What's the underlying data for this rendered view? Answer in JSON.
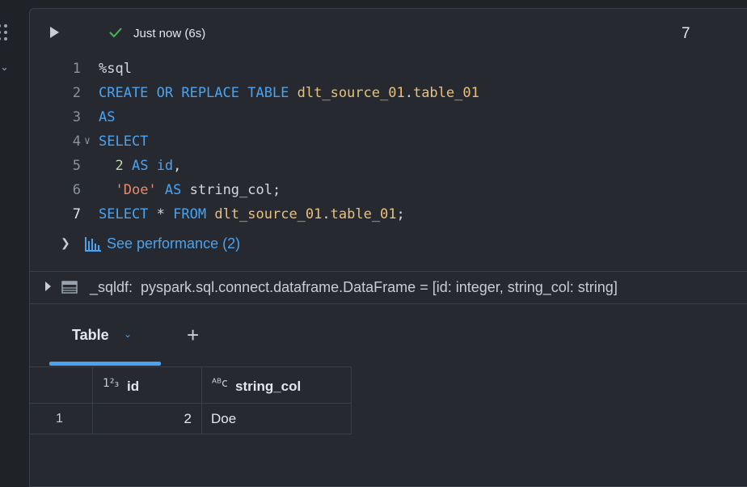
{
  "cell_header": {
    "status_text": "Just now (6s)",
    "execution_count": "7",
    "status_color": "#3fb950"
  },
  "code_lines": [
    {
      "number": "1",
      "parts": [
        {
          "text": "%sql",
          "class": "plain"
        }
      ]
    },
    {
      "number": "2",
      "parts": [
        {
          "text": "CREATE OR REPLACE TABLE ",
          "class": "kw"
        },
        {
          "text": "dlt_source_01",
          "class": "tbl"
        },
        {
          "text": ".",
          "class": "plain"
        },
        {
          "text": "table_01",
          "class": "tbl"
        }
      ]
    },
    {
      "number": "3",
      "parts": [
        {
          "text": "AS",
          "class": "kw"
        }
      ]
    },
    {
      "number": "4",
      "parts": [
        {
          "text": "SELECT",
          "class": "kw"
        }
      ]
    },
    {
      "number": "5",
      "parts": [
        {
          "text": "  ",
          "class": "plain"
        },
        {
          "text": "2",
          "class": "num"
        },
        {
          "text": " AS ",
          "class": "kw"
        },
        {
          "text": "id",
          "class": "kw"
        },
        {
          "text": ",",
          "class": "plain"
        }
      ]
    },
    {
      "number": "6",
      "parts": [
        {
          "text": "  ",
          "class": "plain"
        },
        {
          "text": "'Doe'",
          "class": "str"
        },
        {
          "text": " AS ",
          "class": "kw"
        },
        {
          "text": "string_col;",
          "class": "plain"
        }
      ]
    },
    {
      "number": "7",
      "parts": [
        {
          "text": "SELECT ",
          "class": "kw"
        },
        {
          "text": "* ",
          "class": "plain"
        },
        {
          "text": "FROM ",
          "class": "kw"
        },
        {
          "text": "dlt_source_01",
          "class": "tbl"
        },
        {
          "text": ".",
          "class": "plain"
        },
        {
          "text": "table_01",
          "class": "tbl"
        },
        {
          "text": ";",
          "class": "plain"
        }
      ]
    }
  ],
  "active_line": "7",
  "performance": {
    "label": "See performance (2)"
  },
  "dataframe": {
    "text": "_sqldf:  pyspark.sql.connect.dataframe.DataFrame = [id: integer, string_col: string]"
  },
  "tabs": {
    "table_label": "Table",
    "add_icon": "+"
  },
  "table": {
    "columns": [
      {
        "type_icon": "1²₃",
        "name": "id"
      },
      {
        "type_icon": "ᴬᴮc",
        "name": "string_col"
      }
    ],
    "rows": [
      {
        "index": "1",
        "id": "2",
        "string_col": "Doe"
      }
    ]
  },
  "icons": {
    "drag": "drag-handle-icon",
    "collapse": "chevron-down-icon",
    "run": "play-icon",
    "success": "check-icon",
    "perf": "bar-chart-icon",
    "df": "table-icon"
  },
  "accent_color": "#4aa3f0"
}
